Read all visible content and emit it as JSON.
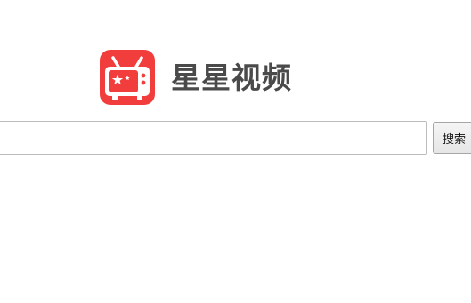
{
  "logo": {
    "icon": "tv-star-logo-icon",
    "text": "星星视频",
    "colors": {
      "brand_red": "#f23d3d",
      "text": "#4a4a4a"
    }
  },
  "search": {
    "value": "",
    "placeholder": "",
    "button_label": "搜索"
  }
}
